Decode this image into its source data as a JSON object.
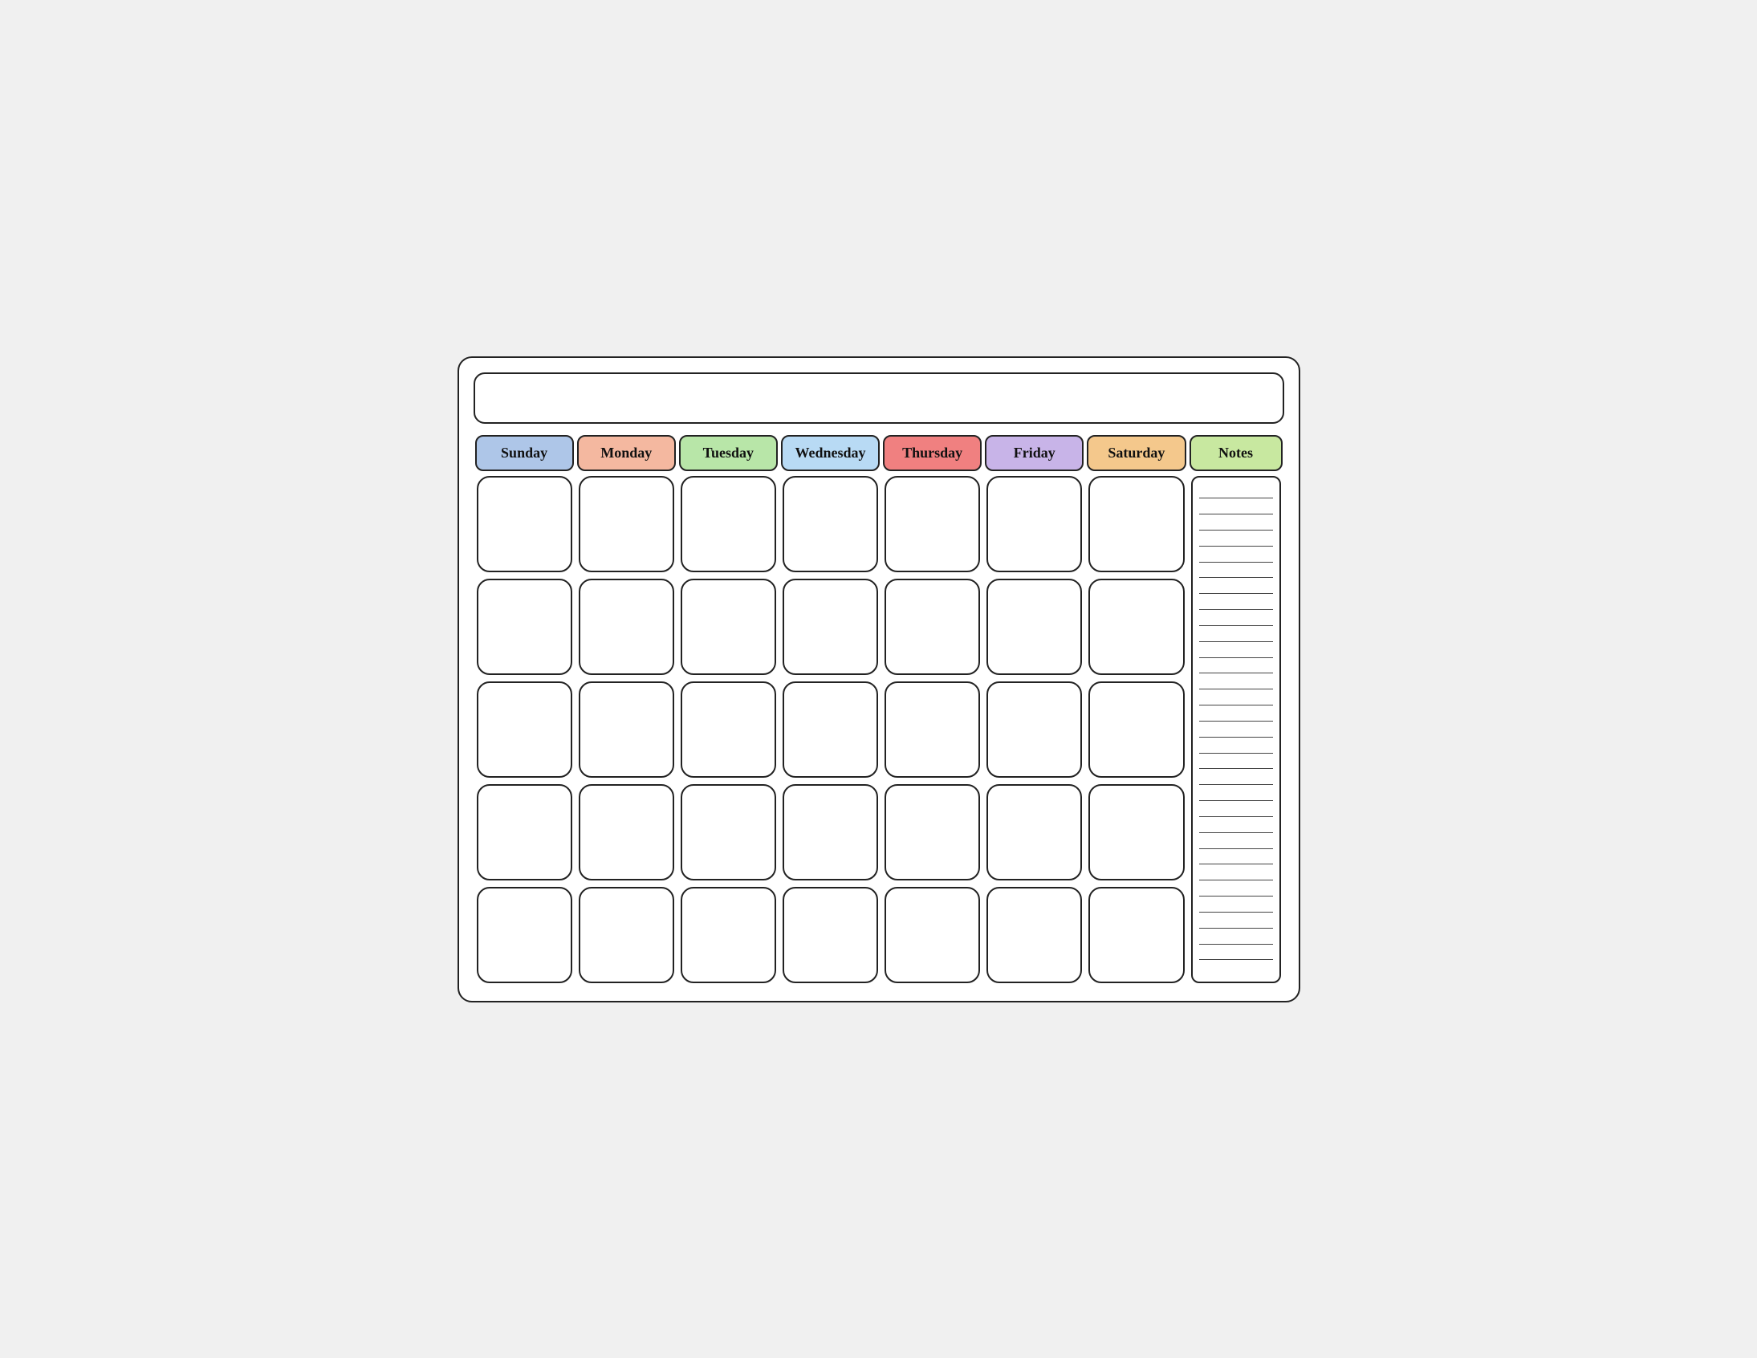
{
  "title": "",
  "days": [
    {
      "label": "Sunday",
      "class": "sunday"
    },
    {
      "label": "Monday",
      "class": "monday"
    },
    {
      "label": "Tuesday",
      "class": "tuesday"
    },
    {
      "label": "Wednesday",
      "class": "wednesday"
    },
    {
      "label": "Thursday",
      "class": "thursday"
    },
    {
      "label": "Friday",
      "class": "friday"
    },
    {
      "label": "Saturday",
      "class": "saturday"
    }
  ],
  "notes_label": "Notes",
  "rows": 5,
  "cols": 7,
  "note_lines": 30
}
